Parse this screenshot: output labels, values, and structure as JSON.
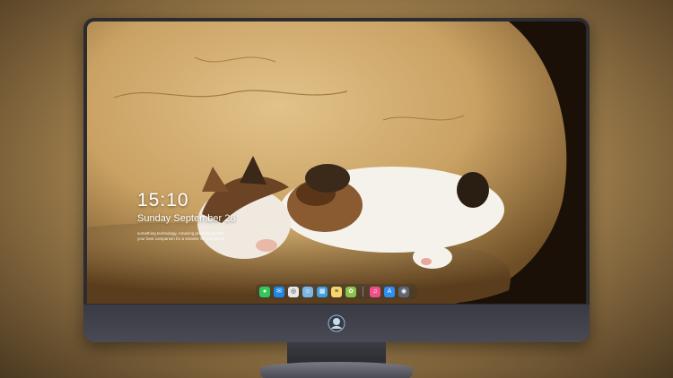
{
  "lock_screen": {
    "time": "15:10",
    "date": "Sunday September 28",
    "note_line1": "something technology, Amazing productivity Mac",
    "note_line2": "your best companion for a smarter life. Excellent"
  },
  "dock": {
    "apps": [
      {
        "name": "messages",
        "color": "#34c759",
        "glyph": "●"
      },
      {
        "name": "mail",
        "color": "#1e88e5",
        "glyph": "✉"
      },
      {
        "name": "safari",
        "color": "#e8e8ea",
        "glyph": "◎"
      },
      {
        "name": "finder",
        "color": "#7cb6e6",
        "glyph": "☺"
      },
      {
        "name": "claquette",
        "color": "#3fa0e0",
        "glyph": "▦"
      },
      {
        "name": "notes",
        "color": "#f6d66b",
        "glyph": "≡"
      },
      {
        "name": "photos",
        "color": "#8bc34a",
        "glyph": "✿"
      },
      {
        "name": "music",
        "color": "#f0508a",
        "glyph": "♫"
      },
      {
        "name": "app-store",
        "color": "#2f8ef0",
        "glyph": "A"
      },
      {
        "name": "camera",
        "color": "#5f6470",
        "glyph": "◉"
      }
    ]
  },
  "colors": {
    "bezel": "#2b2b30",
    "background": "#a88752",
    "wall": "#d8b67c",
    "cat_white": "#f5f2ec"
  }
}
